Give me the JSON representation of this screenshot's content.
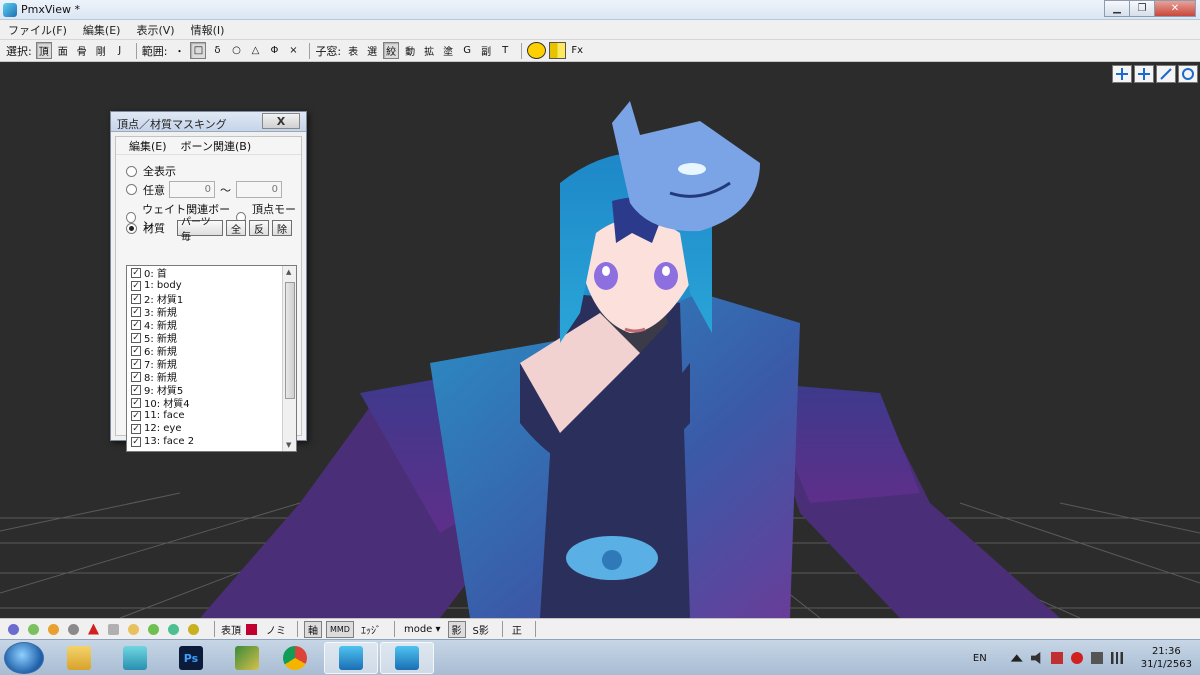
{
  "window": {
    "title": "PmxView *"
  },
  "menubar": {
    "items": [
      "ファイル(F)",
      "編集(E)",
      "表示(V)",
      "情報(I)"
    ]
  },
  "toolbar": {
    "select_label": "選択:",
    "select_items": [
      "頂",
      "面",
      "骨",
      "剛",
      "J"
    ],
    "range_label": "範囲:",
    "range_items": [
      "・",
      "□",
      "δ",
      "○",
      "△",
      "Φ",
      "×"
    ],
    "child_label": "子窓:",
    "child_items": [
      "表",
      "選",
      "絞",
      "動",
      "拡",
      "塗",
      "G",
      "副",
      "T"
    ],
    "fx_label": "Fx"
  },
  "dialog": {
    "title": "頂点／材質マスキング",
    "close_label": "X",
    "menu": [
      "編集(E)",
      "ボーン関連(B)"
    ],
    "show_all": "全表示",
    "arbitrary": "任意",
    "range_from": "0",
    "range_sep": "〜",
    "range_to": "0",
    "weight_bone": "ウェイト関連ボーン",
    "vertex_morph": "頂点モーフ",
    "material": "材質",
    "parts_button": "パーツ毎",
    "all_button": "全",
    "invert_button": "反",
    "remove_button": "除",
    "materials": [
      "0: 首",
      "1: body",
      "2: 材質1",
      "3: 新規",
      "4: 新規",
      "5: 新規",
      "6: 新規",
      "7: 新規",
      "8: 新規",
      "9: 材質5",
      "10: 材質4",
      "11: face",
      "12: eye",
      "13: face 2"
    ]
  },
  "bottombar": {
    "surface_vertex": "表頂",
    "nomi": "ノミ",
    "axis": "軸",
    "mmd": "MMD",
    "edge": "ｴｯｼﾞ",
    "mode": "mode ▾",
    "shadow": "影",
    "s_shadow": "S影",
    "correct": "正"
  },
  "taskbar": {
    "language": "EN",
    "time": "21:36",
    "date": "31/1/2563"
  }
}
